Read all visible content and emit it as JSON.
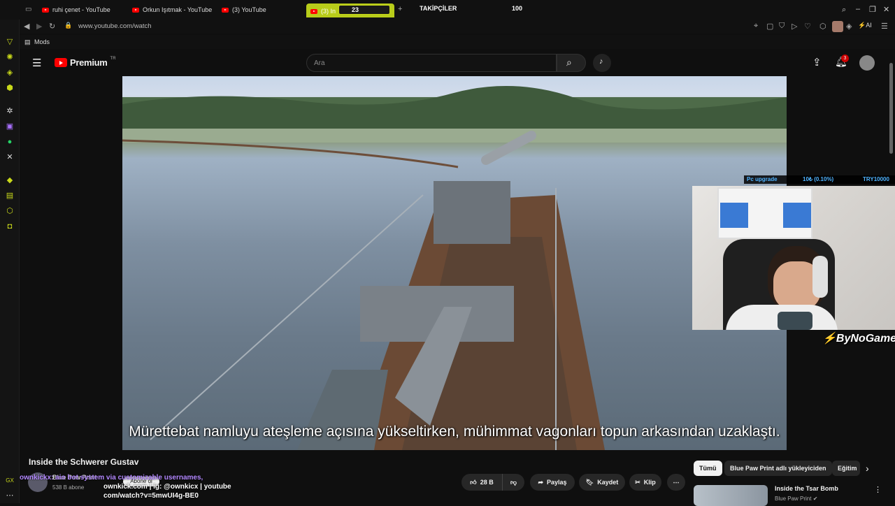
{
  "browser": {
    "tabs": [
      {
        "label": "ruhi çenet - YouTube"
      },
      {
        "label": "Orkun Işıtmak - YouTube"
      },
      {
        "label": "(3) YouTube"
      },
      {
        "label": "(3) In"
      }
    ],
    "url": "www.youtube.com/watch",
    "bookmark": "Mods",
    "ai_label": "AI",
    "notification_count": "3"
  },
  "stream_overlay": {
    "top_counter": "23",
    "followers_label": "TAKİPÇİLER",
    "followers_value": "100",
    "donation_goal_label": "Pc upgrade",
    "donation_progress": "10₺ (0.10%)",
    "donation_target": "TRY10000",
    "streamer_name": "ByNoGame"
  },
  "youtube": {
    "logo": "Premium",
    "region": "TR",
    "search_placeholder": "Ara"
  },
  "video": {
    "subtitle": "Mürettebat namluyu ateşleme açısına yükseltirken, mühimmat vagonları topun arkasından uzaklaştı.",
    "title": "Inside the Schwerer Gustav",
    "channel": "Blue Paw Print",
    "subscribers": "538 B abone",
    "subscribe_label": "Abone ol",
    "likes": "28 B",
    "share_label": "Paylaş",
    "save_label": "Kaydet",
    "clip_label": "Klip"
  },
  "chat": {
    "line1": "ownkickx: aio bot system via customizable usernames,",
    "line2": "ownkick.com | ig: @ownkicx | youtube",
    "line3": "com/watch?v=5mwUI4g-BE0"
  },
  "chips": [
    "Tümü",
    "Blue Paw Print adlı yükleyiciden",
    "Eğitim"
  ],
  "recommendation": {
    "title": "Inside the Tsar Bomb",
    "channel": "Blue Paw Print"
  },
  "colors": {
    "accent": "#c8d81a",
    "youtube_red": "#ff0000",
    "background": "#0f0f0f"
  }
}
